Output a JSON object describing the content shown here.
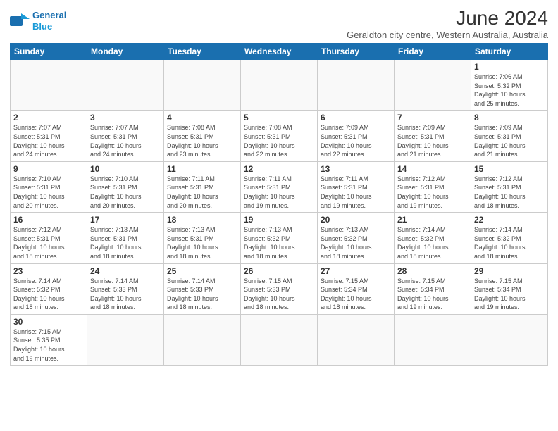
{
  "logo": {
    "line1": "General",
    "line2": "Blue"
  },
  "title": "June 2024",
  "subtitle": "Geraldton city centre, Western Australia, Australia",
  "weekdays": [
    "Sunday",
    "Monday",
    "Tuesday",
    "Wednesday",
    "Thursday",
    "Friday",
    "Saturday"
  ],
  "weeks": [
    [
      {
        "day": "",
        "info": ""
      },
      {
        "day": "",
        "info": ""
      },
      {
        "day": "",
        "info": ""
      },
      {
        "day": "",
        "info": ""
      },
      {
        "day": "",
        "info": ""
      },
      {
        "day": "",
        "info": ""
      },
      {
        "day": "1",
        "info": "Sunrise: 7:06 AM\nSunset: 5:32 PM\nDaylight: 10 hours\nand 25 minutes."
      }
    ],
    [
      {
        "day": "2",
        "info": "Sunrise: 7:07 AM\nSunset: 5:31 PM\nDaylight: 10 hours\nand 24 minutes."
      },
      {
        "day": "3",
        "info": "Sunrise: 7:07 AM\nSunset: 5:31 PM\nDaylight: 10 hours\nand 24 minutes."
      },
      {
        "day": "4",
        "info": "Sunrise: 7:08 AM\nSunset: 5:31 PM\nDaylight: 10 hours\nand 23 minutes."
      },
      {
        "day": "5",
        "info": "Sunrise: 7:08 AM\nSunset: 5:31 PM\nDaylight: 10 hours\nand 22 minutes."
      },
      {
        "day": "6",
        "info": "Sunrise: 7:09 AM\nSunset: 5:31 PM\nDaylight: 10 hours\nand 22 minutes."
      },
      {
        "day": "7",
        "info": "Sunrise: 7:09 AM\nSunset: 5:31 PM\nDaylight: 10 hours\nand 21 minutes."
      },
      {
        "day": "8",
        "info": "Sunrise: 7:09 AM\nSunset: 5:31 PM\nDaylight: 10 hours\nand 21 minutes."
      }
    ],
    [
      {
        "day": "9",
        "info": "Sunrise: 7:10 AM\nSunset: 5:31 PM\nDaylight: 10 hours\nand 20 minutes."
      },
      {
        "day": "10",
        "info": "Sunrise: 7:10 AM\nSunset: 5:31 PM\nDaylight: 10 hours\nand 20 minutes."
      },
      {
        "day": "11",
        "info": "Sunrise: 7:11 AM\nSunset: 5:31 PM\nDaylight: 10 hours\nand 20 minutes."
      },
      {
        "day": "12",
        "info": "Sunrise: 7:11 AM\nSunset: 5:31 PM\nDaylight: 10 hours\nand 19 minutes."
      },
      {
        "day": "13",
        "info": "Sunrise: 7:11 AM\nSunset: 5:31 PM\nDaylight: 10 hours\nand 19 minutes."
      },
      {
        "day": "14",
        "info": "Sunrise: 7:12 AM\nSunset: 5:31 PM\nDaylight: 10 hours\nand 19 minutes."
      },
      {
        "day": "15",
        "info": "Sunrise: 7:12 AM\nSunset: 5:31 PM\nDaylight: 10 hours\nand 18 minutes."
      }
    ],
    [
      {
        "day": "16",
        "info": "Sunrise: 7:12 AM\nSunset: 5:31 PM\nDaylight: 10 hours\nand 18 minutes."
      },
      {
        "day": "17",
        "info": "Sunrise: 7:13 AM\nSunset: 5:31 PM\nDaylight: 10 hours\nand 18 minutes."
      },
      {
        "day": "18",
        "info": "Sunrise: 7:13 AM\nSunset: 5:31 PM\nDaylight: 10 hours\nand 18 minutes."
      },
      {
        "day": "19",
        "info": "Sunrise: 7:13 AM\nSunset: 5:32 PM\nDaylight: 10 hours\nand 18 minutes."
      },
      {
        "day": "20",
        "info": "Sunrise: 7:13 AM\nSunset: 5:32 PM\nDaylight: 10 hours\nand 18 minutes."
      },
      {
        "day": "21",
        "info": "Sunrise: 7:14 AM\nSunset: 5:32 PM\nDaylight: 10 hours\nand 18 minutes."
      },
      {
        "day": "22",
        "info": "Sunrise: 7:14 AM\nSunset: 5:32 PM\nDaylight: 10 hours\nand 18 minutes."
      }
    ],
    [
      {
        "day": "23",
        "info": "Sunrise: 7:14 AM\nSunset: 5:32 PM\nDaylight: 10 hours\nand 18 minutes."
      },
      {
        "day": "24",
        "info": "Sunrise: 7:14 AM\nSunset: 5:33 PM\nDaylight: 10 hours\nand 18 minutes."
      },
      {
        "day": "25",
        "info": "Sunrise: 7:14 AM\nSunset: 5:33 PM\nDaylight: 10 hours\nand 18 minutes."
      },
      {
        "day": "26",
        "info": "Sunrise: 7:15 AM\nSunset: 5:33 PM\nDaylight: 10 hours\nand 18 minutes."
      },
      {
        "day": "27",
        "info": "Sunrise: 7:15 AM\nSunset: 5:34 PM\nDaylight: 10 hours\nand 18 minutes."
      },
      {
        "day": "28",
        "info": "Sunrise: 7:15 AM\nSunset: 5:34 PM\nDaylight: 10 hours\nand 19 minutes."
      },
      {
        "day": "29",
        "info": "Sunrise: 7:15 AM\nSunset: 5:34 PM\nDaylight: 10 hours\nand 19 minutes."
      }
    ],
    [
      {
        "day": "30",
        "info": "Sunrise: 7:15 AM\nSunset: 5:35 PM\nDaylight: 10 hours\nand 19 minutes."
      },
      {
        "day": "",
        "info": ""
      },
      {
        "day": "",
        "info": ""
      },
      {
        "day": "",
        "info": ""
      },
      {
        "day": "",
        "info": ""
      },
      {
        "day": "",
        "info": ""
      },
      {
        "day": "",
        "info": ""
      }
    ]
  ],
  "colors": {
    "header_bg": "#1a6faf",
    "logo_blue": "#1a6faf"
  }
}
